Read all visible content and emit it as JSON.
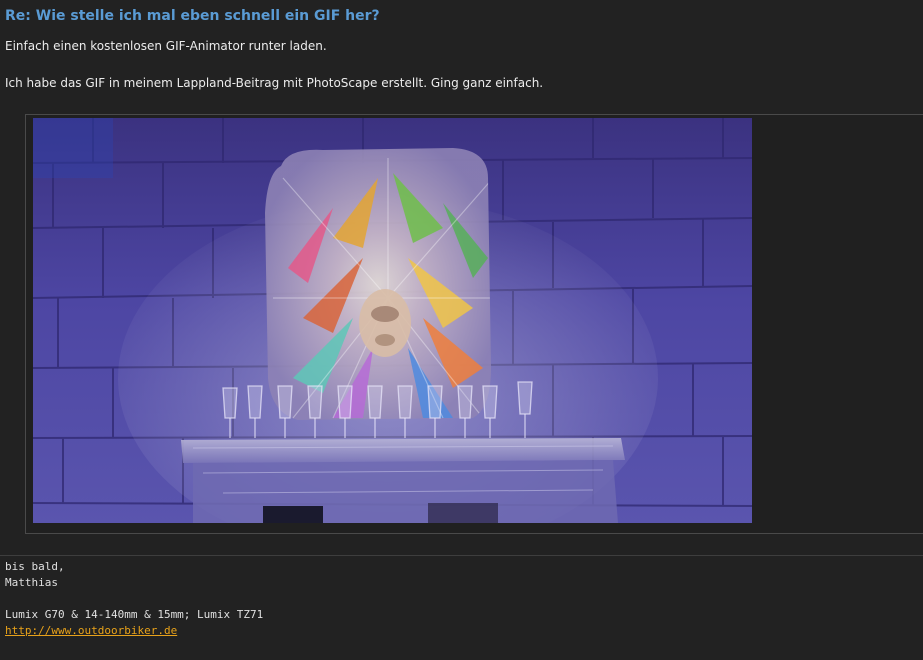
{
  "post": {
    "title": "Re: Wie stelle ich mal eben schnell ein GIF her?",
    "body_lines": [
      "Einfach einen kostenlosen GIF-Animator runter laden.",
      "Ich habe das GIF in meinem Lappland-Beitrag mit PhotoScape erstellt. Ging ganz einfach."
    ]
  },
  "attachment": {
    "image_name": "ice-sculpture-photo"
  },
  "signature": {
    "greeting": "bis bald,",
    "name": "Matthias",
    "gear": "Lumix G70 & 14-140mm & 15mm; Lumix TZ71",
    "link_text": "http://www.outdoorbiker.de"
  },
  "colors": {
    "background": "#222222",
    "title": "#5a9bd4",
    "link": "#e8a21a",
    "text": "#ececec"
  }
}
